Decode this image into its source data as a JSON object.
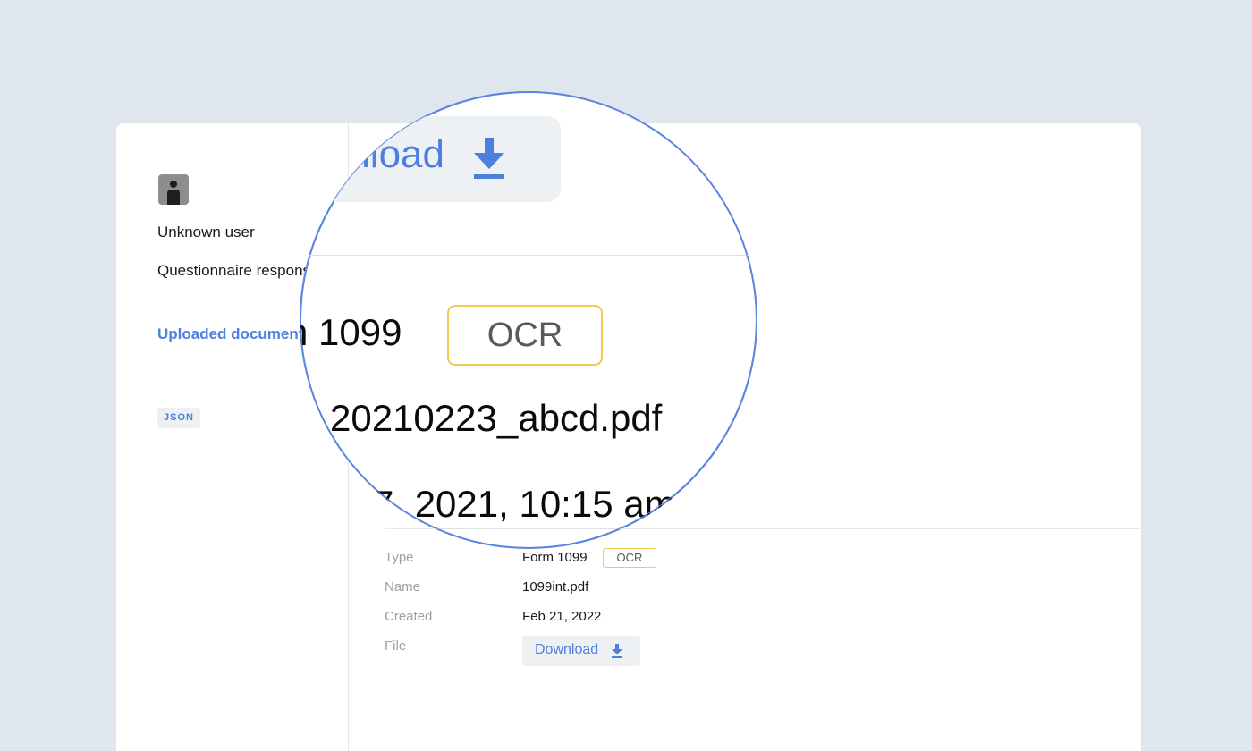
{
  "sidebar": {
    "user_name": "Unknown user",
    "items": [
      {
        "label": "Questionnaire responses"
      },
      {
        "label": "Uploaded documents",
        "active": true
      }
    ],
    "json_badge": "JSON"
  },
  "details": {
    "type_label": "Type",
    "type_value": "Form 1099",
    "type_badge": "OCR",
    "name_label": "Name",
    "name_value": "1099int.pdf",
    "created_label": "Created",
    "created_value": "Feb 21, 2022",
    "file_label": "File",
    "download_label": "Download"
  },
  "magnifier": {
    "download_label": "nload",
    "form_text": "n 1099",
    "ocr_badge": "OCR",
    "filename": "20210223_abcd.pdf",
    "created": "7, 2021, 10:15 am"
  },
  "colors": {
    "accent": "#4c7fde",
    "badge_border": "#f0c94e",
    "background": "#dfe6ed"
  },
  "icons": [
    "user-avatar-icon",
    "download-icon"
  ]
}
